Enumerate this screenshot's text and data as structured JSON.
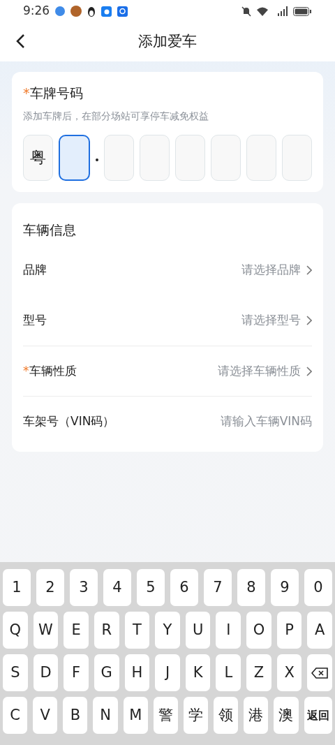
{
  "status_bar": {
    "time": "9:26"
  },
  "header": {
    "title": "添加爱车"
  },
  "plate": {
    "marker": "*",
    "title": "车牌号码",
    "hint": "添加车牌后，在部分场站可享停车减免权益",
    "cells": [
      {
        "value": "粤",
        "selected": false
      },
      {
        "selected": true
      },
      {
        "selected": false
      },
      {
        "selected": false
      },
      {
        "selected": false
      },
      {
        "selected": false
      },
      {
        "selected": false
      },
      {
        "selected": false
      }
    ]
  },
  "vehicle": {
    "title": "车辆信息",
    "rows": [
      {
        "kind": "select",
        "label": "品牌",
        "placeholder": "请选择品牌",
        "divider": false
      },
      {
        "kind": "select",
        "label": "型号",
        "placeholder": "请选择型号",
        "divider": false
      },
      {
        "kind": "select",
        "marker": "*",
        "label": "车辆性质",
        "placeholder": "请选择车辆性质",
        "divider": true
      },
      {
        "kind": "input",
        "label": "车架号（VIN码）",
        "placeholder": "请输入车辆VIN码",
        "divider": true
      }
    ]
  },
  "keyboard": {
    "rows": [
      {
        "keys": [
          {
            "kind": "char",
            "label": "1"
          },
          {
            "kind": "char",
            "label": "2"
          },
          {
            "kind": "char",
            "label": "3"
          },
          {
            "kind": "char",
            "label": "4"
          },
          {
            "kind": "char",
            "label": "5"
          },
          {
            "kind": "char",
            "label": "6"
          },
          {
            "kind": "char",
            "label": "7"
          },
          {
            "kind": "char",
            "label": "8"
          },
          {
            "kind": "char",
            "label": "9"
          },
          {
            "kind": "char",
            "label": "0"
          }
        ]
      },
      {
        "keys": [
          {
            "kind": "char",
            "label": "Q"
          },
          {
            "kind": "char",
            "label": "W"
          },
          {
            "kind": "char",
            "label": "E"
          },
          {
            "kind": "char",
            "label": "R"
          },
          {
            "kind": "char",
            "label": "T"
          },
          {
            "kind": "char",
            "label": "Y"
          },
          {
            "kind": "char",
            "label": "U"
          },
          {
            "kind": "char",
            "label": "I"
          },
          {
            "kind": "char",
            "label": "O"
          },
          {
            "kind": "char",
            "label": "P"
          },
          {
            "kind": "char",
            "label": "A"
          }
        ]
      },
      {
        "keys": [
          {
            "kind": "char",
            "label": "S"
          },
          {
            "kind": "char",
            "label": "D"
          },
          {
            "kind": "char",
            "label": "F"
          },
          {
            "kind": "char",
            "label": "G"
          },
          {
            "kind": "char",
            "label": "H"
          },
          {
            "kind": "char",
            "label": "J"
          },
          {
            "kind": "char",
            "label": "K"
          },
          {
            "kind": "char",
            "label": "L"
          },
          {
            "kind": "char",
            "label": "Z"
          },
          {
            "kind": "char",
            "label": "X"
          },
          {
            "kind": "delete"
          }
        ]
      },
      {
        "keys": [
          {
            "kind": "char",
            "label": "C"
          },
          {
            "kind": "char",
            "label": "V"
          },
          {
            "kind": "char",
            "label": "B"
          },
          {
            "kind": "char",
            "label": "N"
          },
          {
            "kind": "char",
            "label": "M"
          },
          {
            "kind": "char",
            "label": "警"
          },
          {
            "kind": "char",
            "label": "学"
          },
          {
            "kind": "char",
            "label": "领"
          },
          {
            "kind": "char",
            "label": "港"
          },
          {
            "kind": "char",
            "label": "澳"
          },
          {
            "kind": "return",
            "label": "返回"
          }
        ]
      }
    ]
  }
}
